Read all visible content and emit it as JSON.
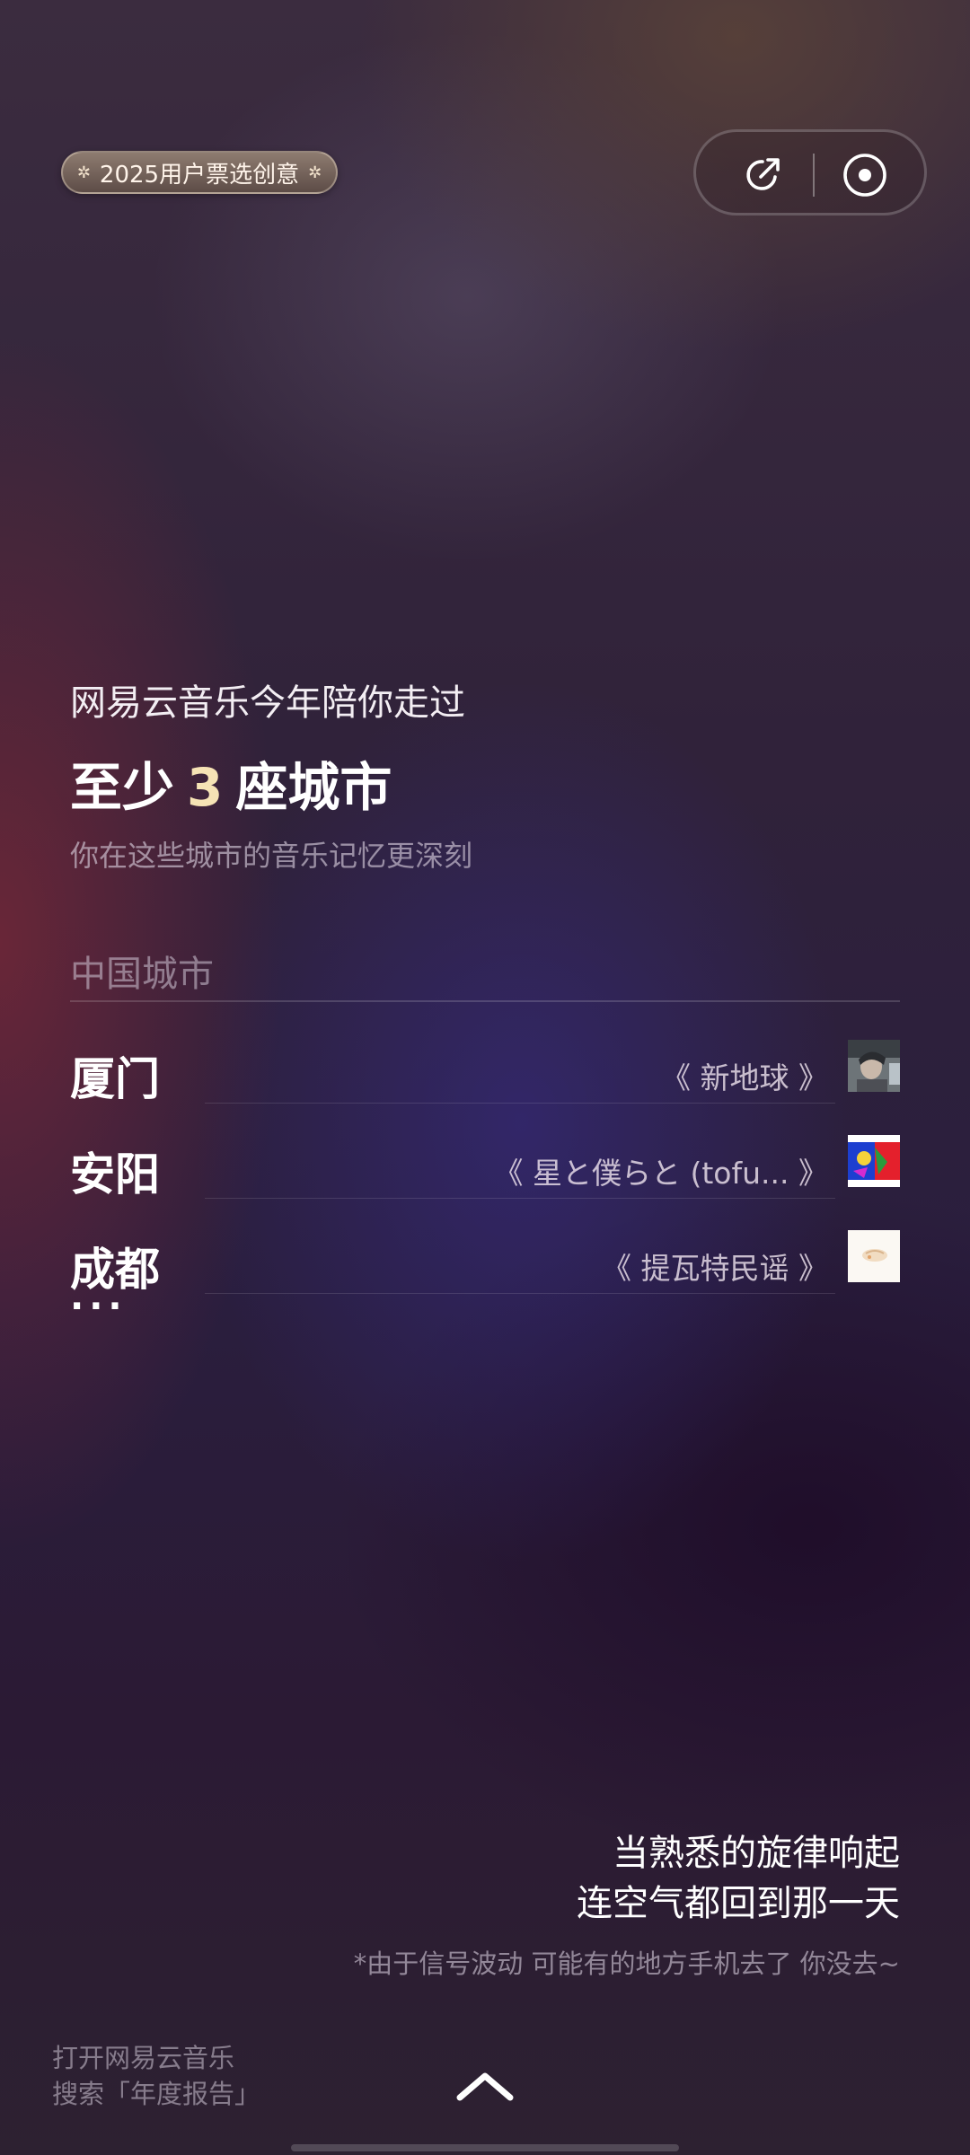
{
  "badge": {
    "label": "2025用户票选创意",
    "deco_icon": "sparkle-icon"
  },
  "top_actions": {
    "share_icon": "share-icon",
    "record_icon": "record-icon"
  },
  "intro": "网易云音乐今年陪你走过",
  "headline": {
    "prefix": "至少",
    "count": "3",
    "suffix": "座城市"
  },
  "subtitle": "你在这些城市的音乐记忆更深刻",
  "section": {
    "title": "中国城市"
  },
  "cities": [
    {
      "name": "厦门",
      "song": "《 新地球 》",
      "cover": "album-cover-portrait"
    },
    {
      "name": "安阳",
      "song": "《 星と僕らと (tofu... 》",
      "cover": "album-cover-colorful"
    },
    {
      "name": "成都",
      "song": "《 提瓦特民谣 》",
      "cover": "album-cover-light"
    }
  ],
  "more": "···",
  "tagline": {
    "line1": "当熟悉的旋律响起",
    "line2": "连空气都回到那一天"
  },
  "disclaimer": "*由于信号波动 可能有的地方手机去了 你没去~",
  "footer": {
    "line1": "打开网易云音乐",
    "line2": "搜索「年度报告」",
    "swipe_icon": "chevron-up-icon"
  },
  "colors": {
    "accent_number": "#f6e3b5",
    "badge_bg": "#7a6a60"
  }
}
